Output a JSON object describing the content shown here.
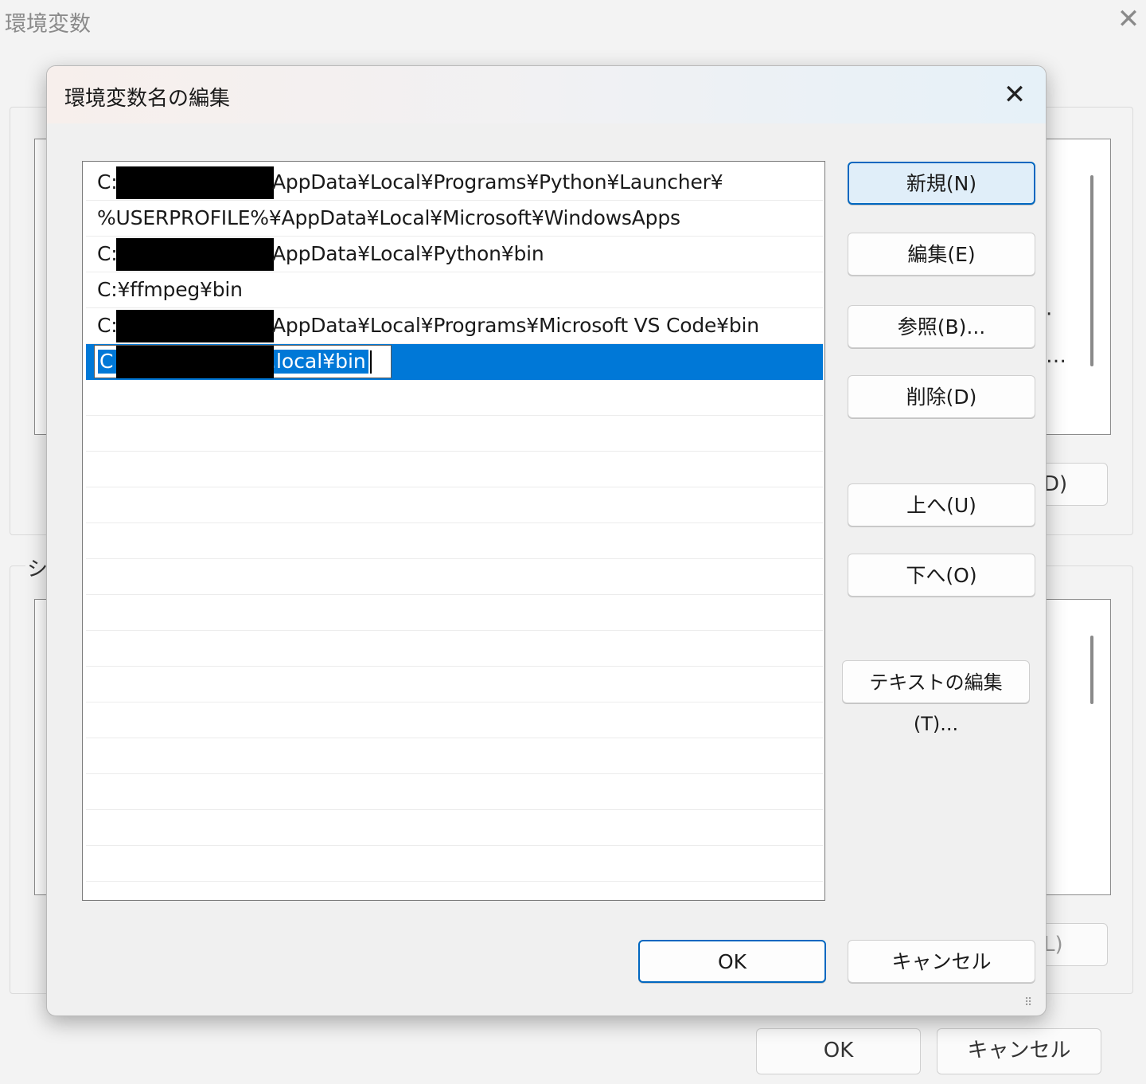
{
  "parent_window": {
    "title": "環境変数",
    "group_label_fragment": "シ",
    "button_fragment_new": "D)",
    "button_fragment_delete": "L)",
    "list_fragment_dot": "·",
    "list_fragment_ellipsis": "…",
    "ok_label": "OK",
    "cancel_label": "キャンセル"
  },
  "dialog": {
    "title": "環境変数名の編集",
    "paths": [
      {
        "prefix": "C:",
        "suffix": "AppData¥Local¥Programs¥Python¥Launcher¥"
      },
      {
        "prefix": "",
        "suffix": "%USERPROFILE%¥AppData¥Local¥Microsoft¥WindowsApps"
      },
      {
        "prefix": "C:",
        "suffix": "AppData¥Local¥Python¥bin"
      },
      {
        "prefix": "",
        "suffix": "C:¥ffmpeg¥bin"
      },
      {
        "prefix": "C:",
        "suffix": "AppData¥Local¥Programs¥Microsoft VS Code¥bin"
      }
    ],
    "editing_entry": {
      "prefix": "C",
      "suffix": ".local¥bin"
    },
    "buttons": {
      "new": "新規(N)",
      "edit": "編集(E)",
      "browse": "参照(B)...",
      "delete": "削除(D)",
      "move_up": "上へ(U)",
      "move_down": "下へ(O)",
      "edit_text": "テキストの編集(T)...",
      "ok": "OK",
      "cancel": "キャンセル"
    },
    "icons": {
      "close": "close-icon",
      "resize_grip": "resize-grip-icon"
    },
    "colors": {
      "selection": "#0078d7",
      "default_button_border": "#0067c0"
    }
  }
}
